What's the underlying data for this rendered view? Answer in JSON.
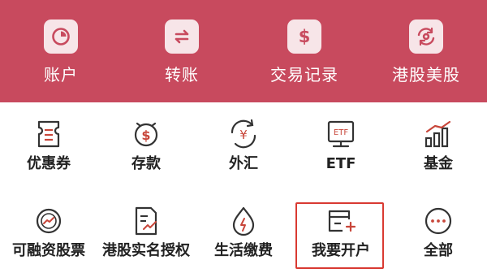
{
  "top_nav": [
    {
      "label": "账户",
      "icon": "pie-chart-icon"
    },
    {
      "label": "转账",
      "icon": "transfer-arrows-icon"
    },
    {
      "label": "交易记录",
      "icon": "dollar-icon"
    },
    {
      "label": "港股美股",
      "icon": "currency-exchange-icon"
    }
  ],
  "services_row1": [
    {
      "label": "优惠券",
      "icon": "coupon-icon"
    },
    {
      "label": "存款",
      "icon": "deposit-icon"
    },
    {
      "label": "外汇",
      "icon": "forex-icon"
    },
    {
      "label": "ETF",
      "icon": "etf-icon",
      "icon_text": "ETF"
    },
    {
      "label": "基金",
      "icon": "fund-chart-icon"
    }
  ],
  "services_row2": [
    {
      "label": "可融资股票",
      "icon": "margin-stock-icon"
    },
    {
      "label": "港股实名授权",
      "icon": "authorization-doc-icon"
    },
    {
      "label": "生活缴费",
      "icon": "utility-payment-icon"
    },
    {
      "label": "我要开户",
      "icon": "open-account-icon"
    },
    {
      "label": "全部",
      "icon": "more-icon"
    }
  ],
  "colors": {
    "accent": "#c84a5e",
    "icon_red": "#c8463a",
    "icon_dark": "#333333",
    "highlight": "#d93a32"
  }
}
